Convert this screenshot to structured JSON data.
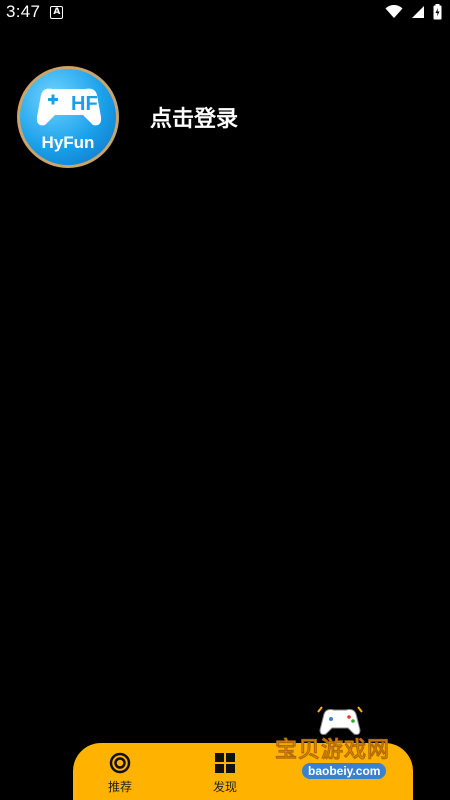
{
  "status_bar": {
    "time": "3:47",
    "notification_glyph": "A"
  },
  "profile": {
    "app_logo_text": "HyFun",
    "login_label": "点击登录"
  },
  "bottom_nav": {
    "tabs": [
      {
        "label": "推荐",
        "icon": "target-icon"
      },
      {
        "label": "发现",
        "icon": "grid-icon"
      }
    ]
  },
  "watermark": {
    "text": "宝贝游戏网",
    "url": "baobeiy.com"
  },
  "colors": {
    "accent": "#ffb300",
    "background": "#000000",
    "avatar_border": "#caa46a"
  }
}
